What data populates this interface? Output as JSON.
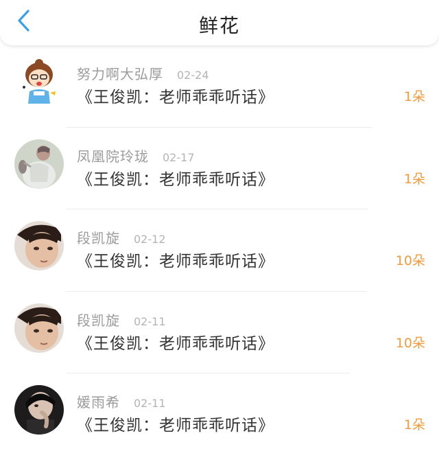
{
  "header": {
    "title": "鲜花",
    "back_icon": "chevron-left-icon",
    "accent_color": "#3aa0e8"
  },
  "count_color": "#f29a3c",
  "items": [
    {
      "name": "努力啊大弘厚",
      "date": "02-24",
      "title": "《王俊凯：老师乖乖听话》",
      "count": "1朵"
    },
    {
      "name": "凤凰院玲珑",
      "date": "02-17",
      "title": "《王俊凯：老师乖乖听话》",
      "count": "1朵"
    },
    {
      "name": "段凯旋",
      "date": "02-12",
      "title": "《王俊凯：老师乖乖听话》",
      "count": "10朵"
    },
    {
      "name": "段凯旋",
      "date": "02-11",
      "title": "《王俊凯：老师乖乖听话》",
      "count": "10朵"
    },
    {
      "name": "媛雨希",
      "date": "02-11",
      "title": "《王俊凯：老师乖乖听话》",
      "count": "1朵"
    }
  ]
}
